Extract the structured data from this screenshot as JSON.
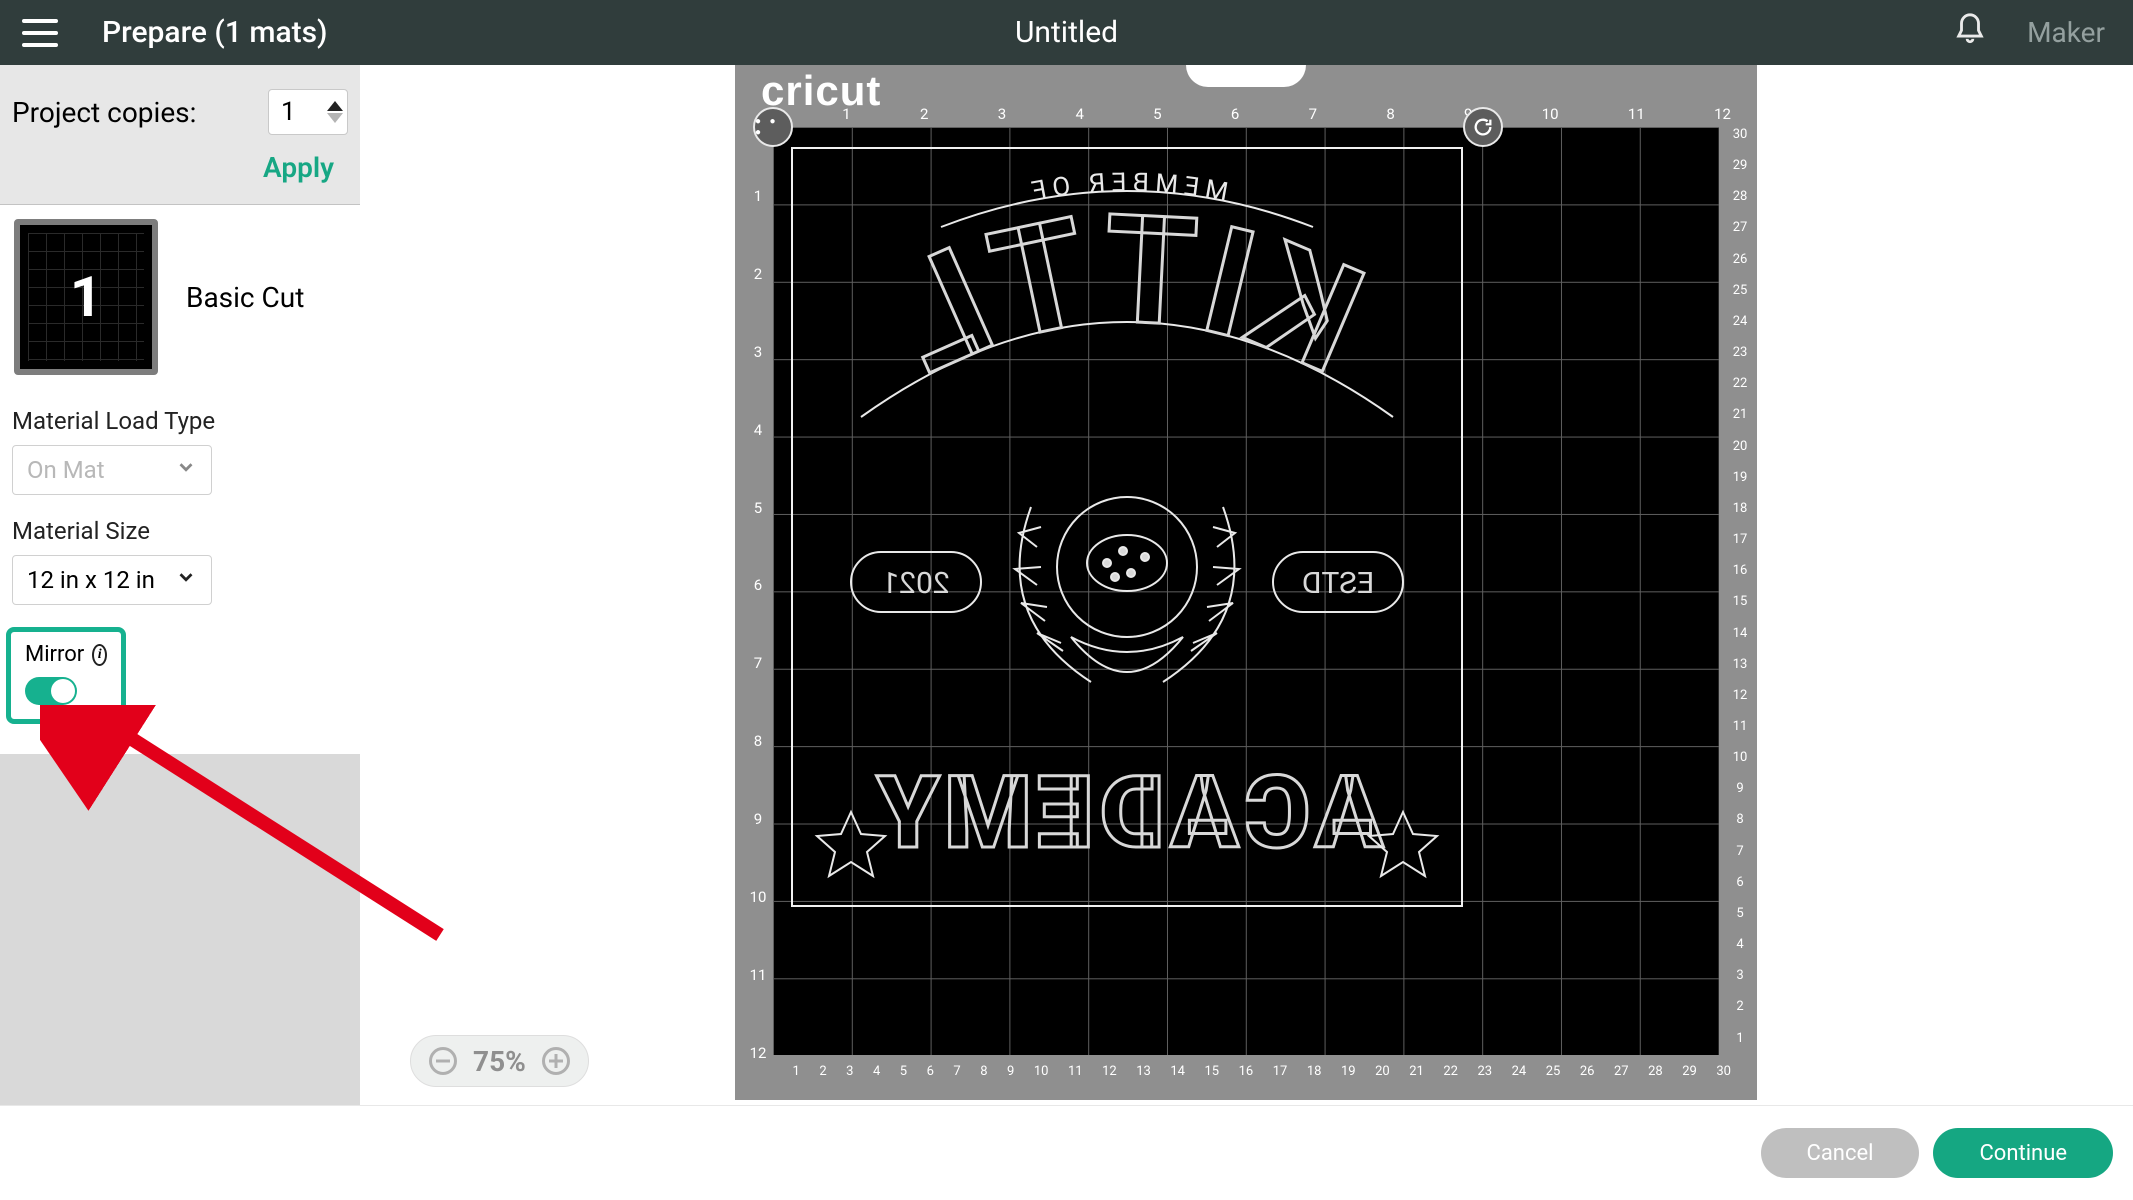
{
  "topbar": {
    "prepare": "Prepare (1 mats)",
    "title": "Untitled",
    "machine": "Maker"
  },
  "project_copies": {
    "label": "Project copies:",
    "value": "1",
    "apply": "Apply"
  },
  "mat": {
    "number": "1",
    "mode": "Basic Cut"
  },
  "settings": {
    "load_label": "Material Load Type",
    "load_value": "On Mat",
    "size_label": "Material Size",
    "size_value": "12 in x 12 in",
    "mirror_label": "Mirror",
    "mirror_on": true
  },
  "zoom": {
    "level": "75%"
  },
  "mat_view": {
    "brand": "cricut",
    "inch_top": [
      "",
      "1",
      "2",
      "3",
      "4",
      "5",
      "6",
      "7",
      "8",
      "9",
      "10",
      "11",
      "12"
    ],
    "inch_left": [
      "",
      "1",
      "2",
      "3",
      "4",
      "5",
      "6",
      "7",
      "8",
      "9",
      "10",
      "11",
      "12"
    ],
    "cm_right": [
      "30",
      "29",
      "28",
      "27",
      "26",
      "25",
      "24",
      "23",
      "22",
      "21",
      "20",
      "19",
      "18",
      "17",
      "16",
      "15",
      "14",
      "13",
      "12",
      "11",
      "10",
      "9",
      "8",
      "7",
      "6",
      "5",
      "4",
      "3",
      "2",
      "1",
      ""
    ],
    "cm_bottom": [
      "30",
      "29",
      "28",
      "27",
      "26",
      "25",
      "24",
      "23",
      "22",
      "21",
      "20",
      "19",
      "18",
      "17",
      "16",
      "15",
      "14",
      "13",
      "12",
      "11",
      "10",
      "9",
      "8",
      "7",
      "6",
      "5",
      "4",
      "3",
      "2",
      "1",
      ""
    ],
    "design_text": {
      "arc": "MEMBER OF",
      "main": "KITTL",
      "left_pill": "2021",
      "right_pill": "ESTD",
      "bottom": "ACADEMY"
    }
  },
  "footer": {
    "cancel": "Cancel",
    "continue": "Continue"
  }
}
